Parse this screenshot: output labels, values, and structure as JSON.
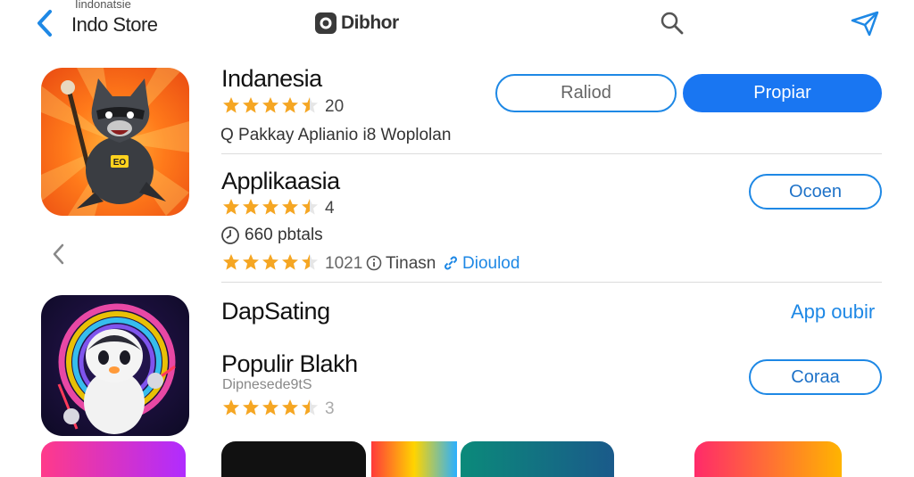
{
  "header": {
    "store_subtitle": "Iindonatsie",
    "store_title": "Indo Store",
    "brand_name": "Dibhor"
  },
  "apps": [
    {
      "title": "Indanesia",
      "rating": "20",
      "stars": 4.5,
      "meta": "Q Pakkay Aplianio i8  Woplolan",
      "buttons": [
        "Raliod",
        "Propiar"
      ]
    },
    {
      "title": "Applikaasia",
      "rating": "4",
      "stars": 4.5,
      "meta": "660 pbtals",
      "meta2_rating": "1021",
      "meta2_text": "Tinasn",
      "meta2_link": "Dioulod",
      "button": "Ocoen"
    },
    {
      "title": "DapSating",
      "link": "App oubir"
    },
    {
      "title": "Populir Blakh",
      "subtitle": "Dipnesede9tS",
      "rating": "3",
      "stars": 4.5,
      "button": "Coraa"
    }
  ],
  "colors": {
    "accent": "#1976f2",
    "star": "#f5a623",
    "divider": "#dcdcdc"
  },
  "icons": [
    "back-chevron-icon",
    "camera-icon",
    "search-icon",
    "send-icon",
    "star-icon",
    "clock-icon",
    "info-icon",
    "link-icon"
  ]
}
